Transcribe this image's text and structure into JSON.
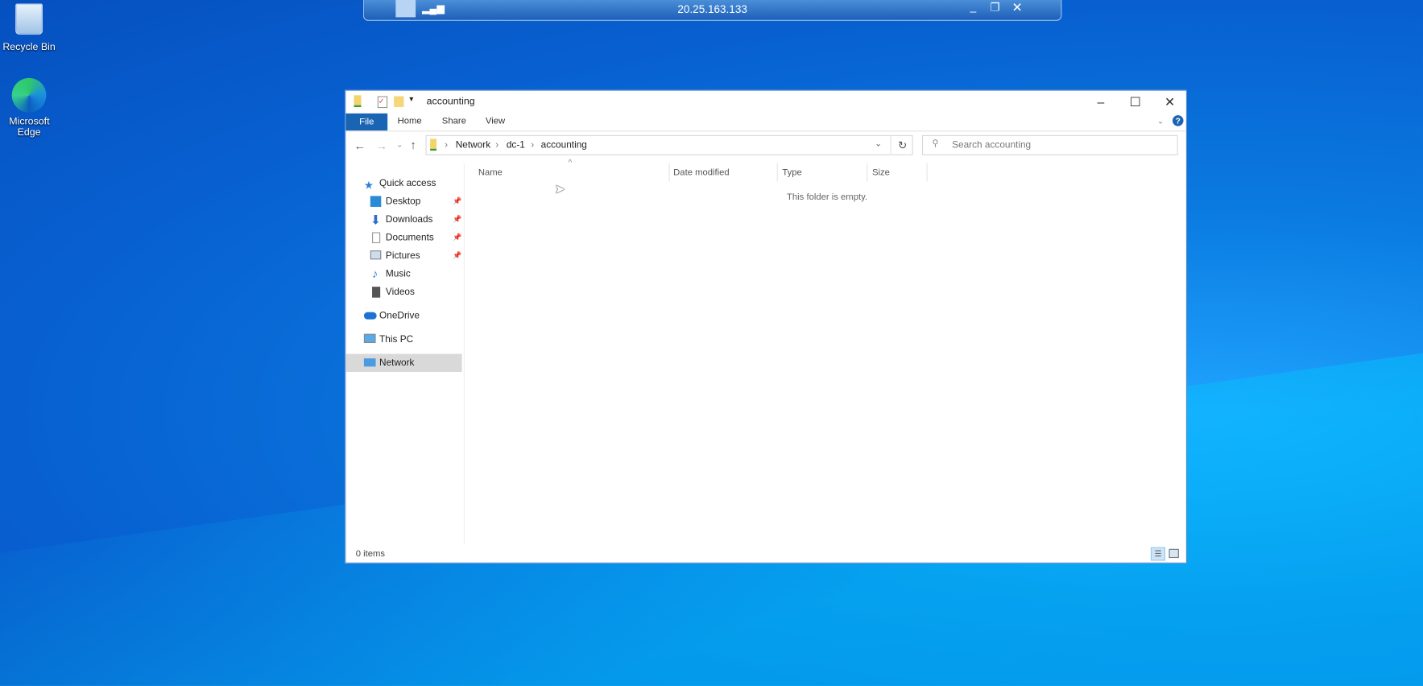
{
  "desktop": {
    "icons": [
      {
        "label": "Recycle Bin"
      },
      {
        "label": "Microsoft Edge"
      }
    ]
  },
  "rdp_bar": {
    "host": "20.25.163.133"
  },
  "explorer": {
    "title": "accounting",
    "ribbon_tabs": [
      "File",
      "Home",
      "Share",
      "View"
    ],
    "breadcrumb": [
      "Network",
      "dc-1",
      "accounting"
    ],
    "search_placeholder": "Search accounting",
    "nav": {
      "quick_access": "Quick access",
      "quick_items": [
        {
          "label": "Desktop",
          "pinned": true
        },
        {
          "label": "Downloads",
          "pinned": true
        },
        {
          "label": "Documents",
          "pinned": true
        },
        {
          "label": "Pictures",
          "pinned": true
        },
        {
          "label": "Music",
          "pinned": false
        },
        {
          "label": "Videos",
          "pinned": false
        }
      ],
      "onedrive": "OneDrive",
      "this_pc": "This PC",
      "network": "Network"
    },
    "columns": [
      "Name",
      "Date modified",
      "Type",
      "Size"
    ],
    "empty_message": "This folder is empty.",
    "status": "0 items",
    "colors": {
      "accent": "#1a64b4",
      "selected": "#d9d9d9"
    }
  }
}
